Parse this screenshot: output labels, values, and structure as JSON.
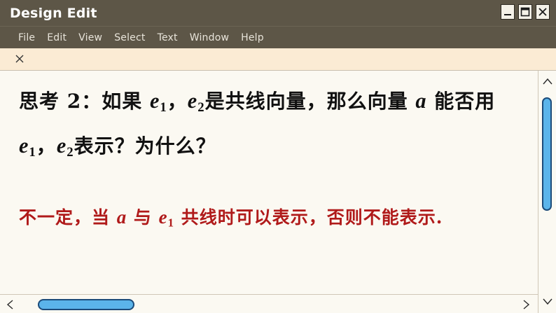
{
  "window": {
    "title": "Design Edit",
    "controls": [
      "minimize-icon",
      "maximize-icon",
      "close-icon"
    ]
  },
  "menu": {
    "items": [
      "File",
      "Edit",
      "View",
      "Select",
      "Text",
      "Window",
      "Help"
    ]
  },
  "tab": {
    "close_icon": "close-icon"
  },
  "content": {
    "q_label": "思考 2：",
    "q_text_1": "如果 ",
    "e": "e",
    "sub1": "1",
    "sub2": "2",
    "comma": "，",
    "q_text_2": "是共线向量，那么向量 ",
    "a": "a",
    "q_text_3": " 能否用",
    "q_text_4": "表示？为什么？",
    "ans_1": "不一定，当 ",
    "ans_2": " 与 ",
    "ans_3": " 共线时可以表示，否则不能表示."
  },
  "colors": {
    "titlebar": "#5d5647",
    "tabstrip": "#fbebd4",
    "answer_text": "#b01a1a",
    "scroll_thumb": "#5bb4ea"
  }
}
